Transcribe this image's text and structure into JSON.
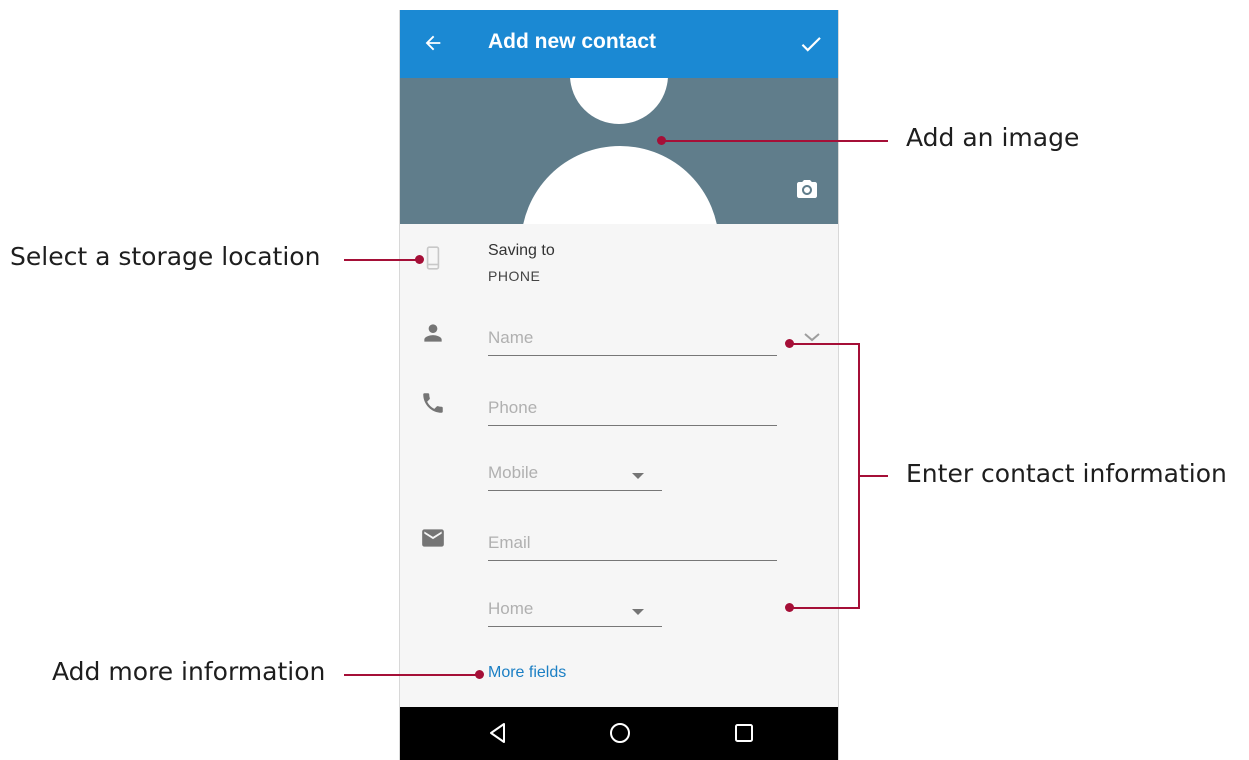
{
  "appbar": {
    "title": "Add new contact",
    "back_icon": "arrow-left-icon",
    "done_icon": "check-icon"
  },
  "photo": {
    "camera_icon": "camera-icon"
  },
  "storage": {
    "label": "Saving to",
    "value": "PHONE",
    "icon": "phone-device-icon"
  },
  "fields": {
    "name_placeholder": "Name",
    "phone_placeholder": "Phone",
    "phone_type": "Mobile",
    "email_placeholder": "Email",
    "email_type": "Home"
  },
  "more_fields": "More fields",
  "navbar": {
    "back": "nav-back-icon",
    "home": "nav-home-icon",
    "recents": "nav-recents-icon"
  },
  "callouts": {
    "add_image": "Add an image",
    "storage": "Select a storage location",
    "contact_info": "Enter contact information",
    "more_info": "Add more information"
  },
  "colors": {
    "accent": "#1b89d3",
    "photo_bg": "#607d8b",
    "callout_line": "#a50f37",
    "link": "#1b7fc4"
  }
}
